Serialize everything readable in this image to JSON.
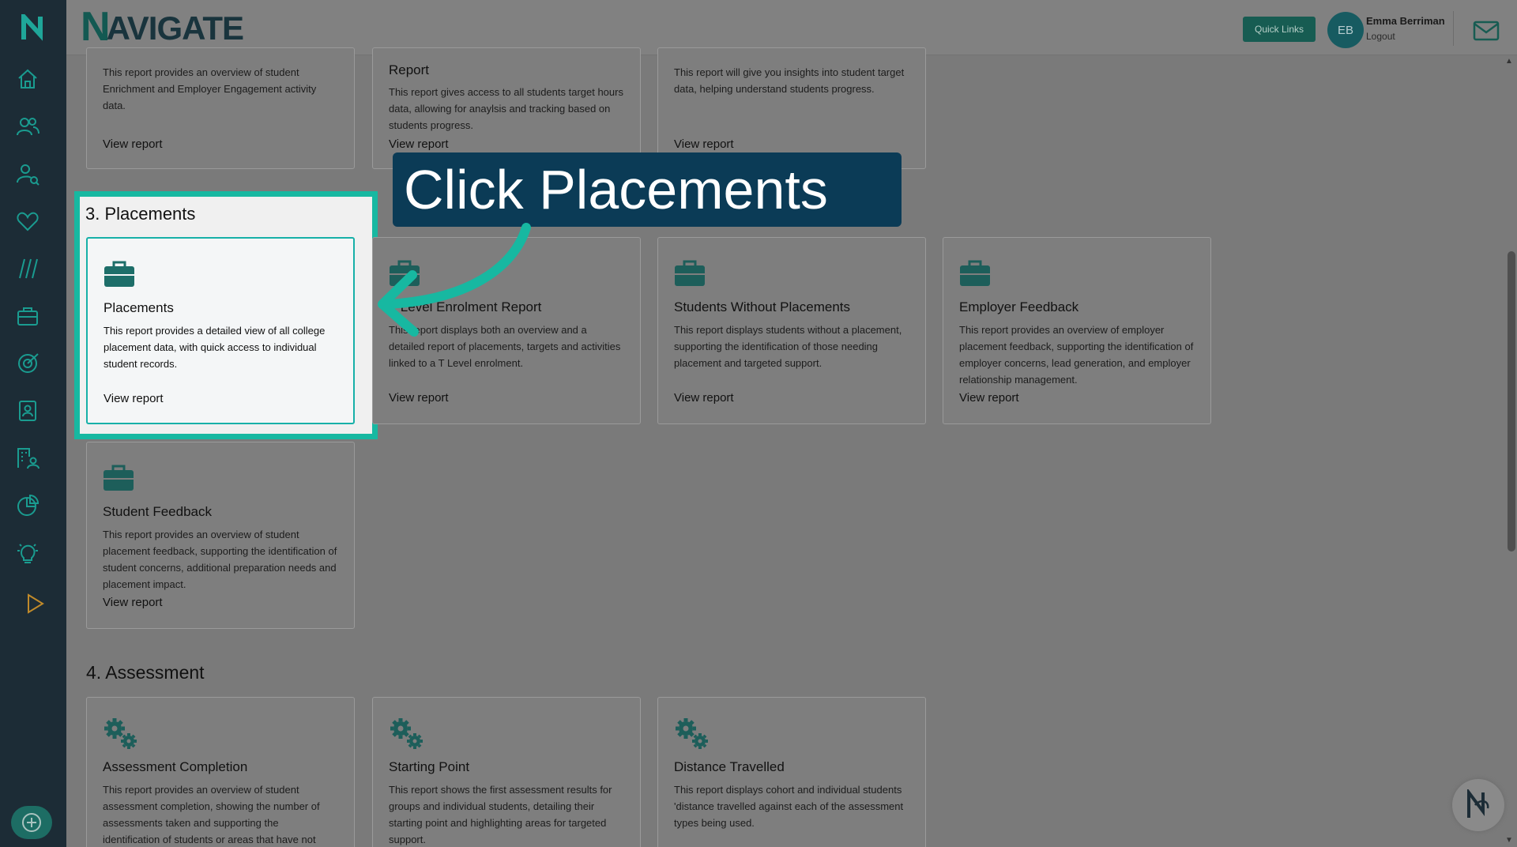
{
  "header": {
    "brand": "NAVIGATE",
    "quick_links": "Quick Links",
    "user_initials": "EB",
    "user_name": "Emma Berriman",
    "logout": "Logout"
  },
  "callout": "Click Placements",
  "sections": {
    "placements": "3. Placements",
    "assessment": "4. Assessment"
  },
  "top_cards": [
    {
      "title": "",
      "desc": "This report provides an overview of student Enrichment and Employer Engagement activity data.",
      "link": "View report"
    },
    {
      "title": "Report",
      "desc": "This report gives access to all students target hours data, allowing for anaylsis and tracking based on students progress.",
      "link": "View report"
    },
    {
      "title": "",
      "desc": "This report will give you insights into student target data, helping understand students progress.",
      "link": "View report"
    }
  ],
  "placement_cards": [
    {
      "title": "Placements",
      "desc": "This report provides a detailed view of all college placement data, with quick access to individual student records.",
      "link": "View report"
    },
    {
      "title": "T Level Enrolment Report",
      "desc": "This report displays both an overview and a detailed report of placements, targets and activities linked to a T Level enrolment.",
      "link": "View report"
    },
    {
      "title": "Students Without Placements",
      "desc": "This report displays students without a placement, supporting the identification of those needing placement and targeted support.",
      "link": "View report"
    },
    {
      "title": "Employer Feedback",
      "desc": "This report provides an overview of employer placement feedback, supporting the identification of employer concerns, lead generation, and employer relationship management.",
      "link": "View report"
    },
    {
      "title": "Student Feedback",
      "desc": "This report provides an overview of student placement feedback, supporting the identification of student concerns, additional preparation needs and placement impact.",
      "link": "View report"
    }
  ],
  "assessment_cards": [
    {
      "title": "Assessment Completion",
      "desc": "This report provides an overview of student assessment completion, showing the number of assessments taken and supporting the identification of students or areas that have not"
    },
    {
      "title": "Starting Point",
      "desc": "This report shows the first assessment results for groups and individual students, detailing their starting point and highlighting areas for targeted support."
    },
    {
      "title": "Distance Travelled",
      "desc": "This report displays cohort and individual students 'distance travelled against each of the assessment types being used."
    }
  ],
  "colors": {
    "accent": "#17b8a1",
    "callout": "#0b3b56",
    "sidebar": "#1c2c36"
  }
}
